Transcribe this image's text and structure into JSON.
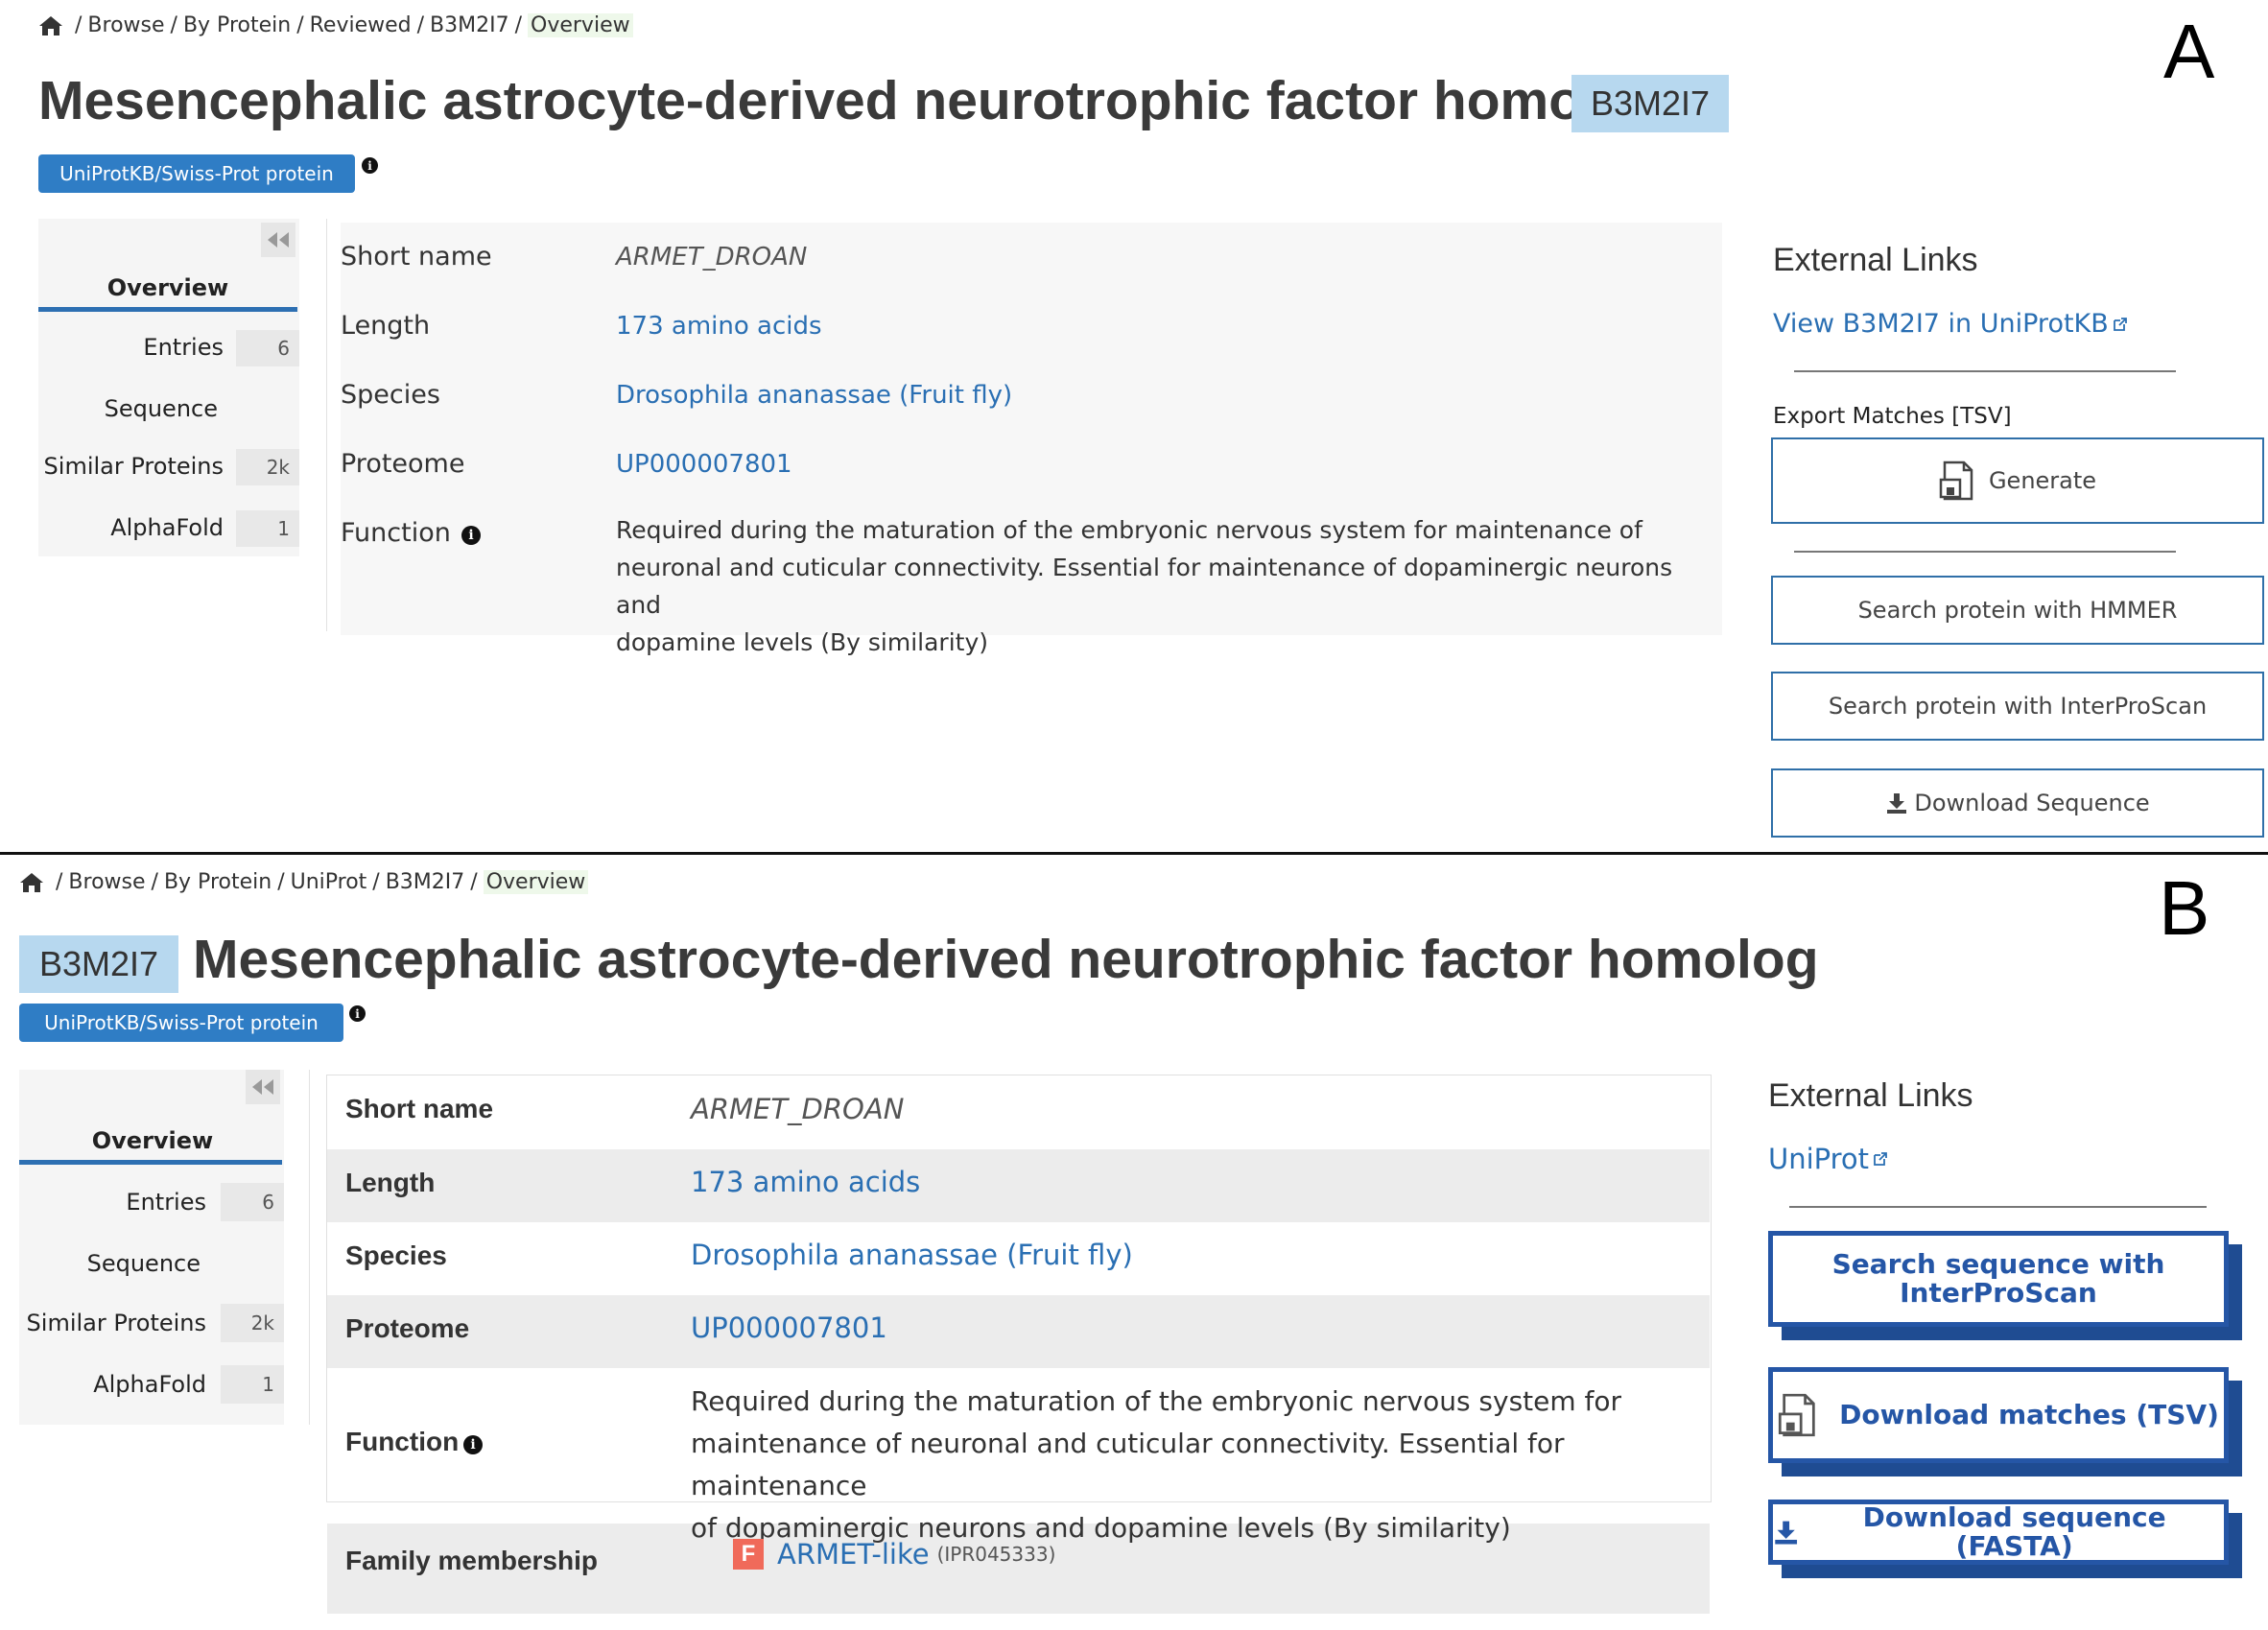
{
  "panel_a": {
    "letter": "A",
    "breadcrumb": [
      "Browse",
      "By Protein",
      "Reviewed",
      "B3M2I7",
      "Overview"
    ],
    "title": "Mesencephalic astrocyte-derived neurotrophic factor homolog",
    "accession": "B3M2I7",
    "badge": "UniProtKB/Swiss-Prot protein",
    "menu": {
      "overview": "Overview",
      "items": [
        {
          "label": "Entries",
          "count": "6"
        },
        {
          "label": "Sequence",
          "count": ""
        },
        {
          "label": "Similar Proteins",
          "count": "2k"
        },
        {
          "label": "AlphaFold",
          "count": "1"
        }
      ]
    },
    "table": {
      "short_name_label": "Short name",
      "short_name": "ARMET_DROAN",
      "length_label": "Length",
      "length": "173 amino acids",
      "species_label": "Species",
      "species": "Drosophila ananassae (Fruit fly)",
      "proteome_label": "Proteome",
      "proteome": "UP000007801",
      "function_label": "Function",
      "function_lines": [
        "Required during the maturation of the embryonic nervous system for maintenance of",
        "neuronal and cuticular connectivity. Essential for maintenance of dopaminergic neurons and",
        "dopamine levels (By similarity)"
      ]
    },
    "external": {
      "title": "External Links",
      "link": "View B3M2I7 in UniProtKB",
      "export_label": "Export Matches [TSV]",
      "generate": "Generate",
      "hmmer": "Search protein with HMMER",
      "interproscan": "Search protein with InterProScan",
      "download": "Download Sequence"
    }
  },
  "panel_b": {
    "letter": "B",
    "breadcrumb": [
      "Browse",
      "By Protein",
      "UniProt",
      "B3M2I7",
      "Overview"
    ],
    "title": "Mesencephalic astrocyte-derived neurotrophic factor homolog",
    "accession": "B3M2I7",
    "badge": "UniProtKB/Swiss-Prot protein",
    "menu": {
      "overview": "Overview",
      "items": [
        {
          "label": "Entries",
          "count": "6"
        },
        {
          "label": "Sequence",
          "count": ""
        },
        {
          "label": "Similar Proteins",
          "count": "2k"
        },
        {
          "label": "AlphaFold",
          "count": "1"
        }
      ]
    },
    "table": {
      "short_name_label": "Short name",
      "short_name": "ARMET_DROAN",
      "length_label": "Length",
      "length": "173 amino acids",
      "species_label": "Species",
      "species": "Drosophila ananassae (Fruit fly)",
      "proteome_label": "Proteome",
      "proteome": "UP000007801",
      "function_label": "Function",
      "function_lines": [
        "Required during the maturation of the embryonic nervous system for",
        "maintenance of neuronal and cuticular connectivity. Essential for maintenance",
        "of dopaminergic neurons and dopamine levels (By similarity)"
      ],
      "family_label": "Family membership",
      "family_icon_letter": "F",
      "family_name": "ARMET-like",
      "family_accession": "(IPR045333)"
    },
    "external": {
      "title": "External Links",
      "link": "UniProt",
      "interproscan_line1": "Search sequence with",
      "interproscan_line2": "InterProScan",
      "download_matches": "Download matches (TSV)",
      "download_sequence": "Download sequence (FASTA)"
    }
  },
  "colors": {
    "link": "#2a6fb3",
    "badge": "#2f7dc5",
    "accession_bg": "#b7d8ef",
    "button_b": "#2556a6",
    "family_icon": "#f06a5a"
  }
}
